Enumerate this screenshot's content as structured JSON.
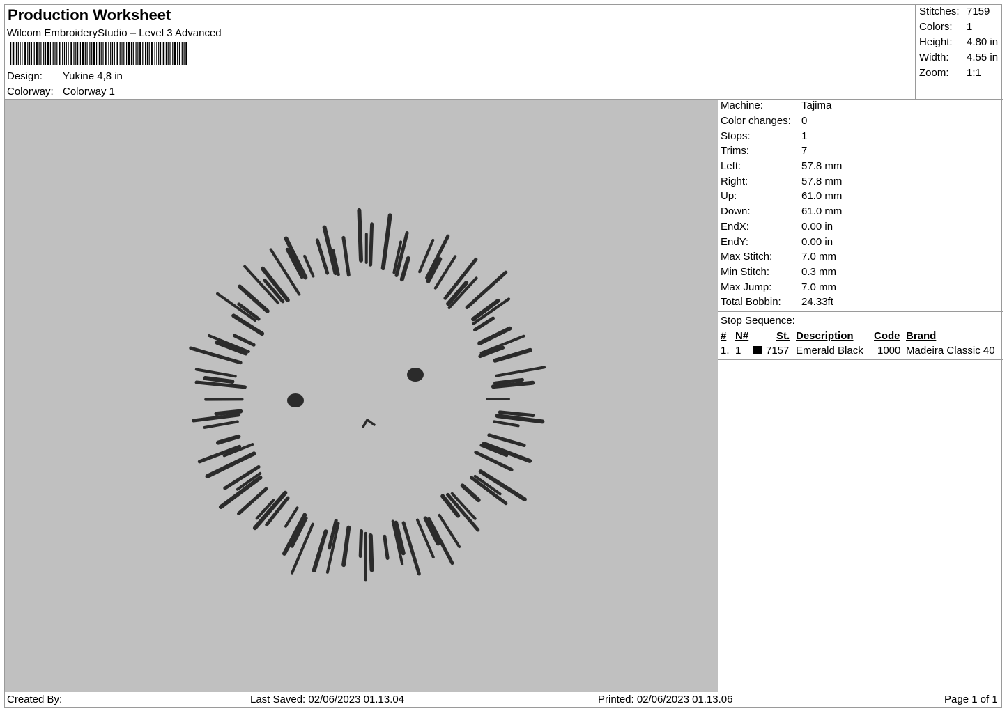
{
  "header": {
    "title": "Production Worksheet",
    "subtitle": "Wilcom EmbroideryStudio – Level 3 Advanced",
    "design_label": "Design:",
    "design_value": "Yukine 4,8 in",
    "colorway_label": "Colorway:",
    "colorway_value": "Colorway 1"
  },
  "stats": [
    {
      "label": "Stitches:",
      "value": "7159"
    },
    {
      "label": "Colors:",
      "value": "1"
    },
    {
      "label": "Height:",
      "value": "4.80 in"
    },
    {
      "label": "Width:",
      "value": "4.55 in"
    },
    {
      "label": "Zoom:",
      "value": "1:1"
    }
  ],
  "specs": [
    {
      "label": "Machine:",
      "value": "Tajima"
    },
    {
      "label": "Color changes:",
      "value": "0"
    },
    {
      "label": "Stops:",
      "value": "1"
    },
    {
      "label": "Trims:",
      "value": "7"
    },
    {
      "label": "Left:",
      "value": "57.8 mm"
    },
    {
      "label": "Right:",
      "value": "57.8 mm"
    },
    {
      "label": "Up:",
      "value": "61.0 mm"
    },
    {
      "label": "Down:",
      "value": "61.0 mm"
    },
    {
      "label": "EndX:",
      "value": "0.00 in"
    },
    {
      "label": "EndY:",
      "value": "0.00 in"
    },
    {
      "label": "Max Stitch:",
      "value": "7.0 mm"
    },
    {
      "label": "Min Stitch:",
      "value": "0.3 mm"
    },
    {
      "label": "Max Jump:",
      "value": "7.0 mm"
    },
    {
      "label": "Total Bobbin:",
      "value": "24.33ft"
    }
  ],
  "stop_sequence": {
    "heading": "Stop Sequence:",
    "columns": {
      "num": "#",
      "n": "N#",
      "st": "St.",
      "description": "Description",
      "code": "Code",
      "brand": "Brand"
    },
    "rows": [
      {
        "num": "1.",
        "n": "1",
        "swatch_color": "#000000",
        "st": "7157",
        "description": "Emerald Black",
        "code": "1000",
        "brand": "Madeira Classic 40"
      }
    ]
  },
  "preview": {
    "background_color": "#c0c0c0",
    "thread_color": "#2b2b2b"
  },
  "footer": {
    "created_by": "Created By:",
    "last_saved": "Last Saved: 02/06/2023 01.13.04",
    "printed": "Printed: 02/06/2023 01.13.06",
    "page": "Page 1 of 1"
  }
}
